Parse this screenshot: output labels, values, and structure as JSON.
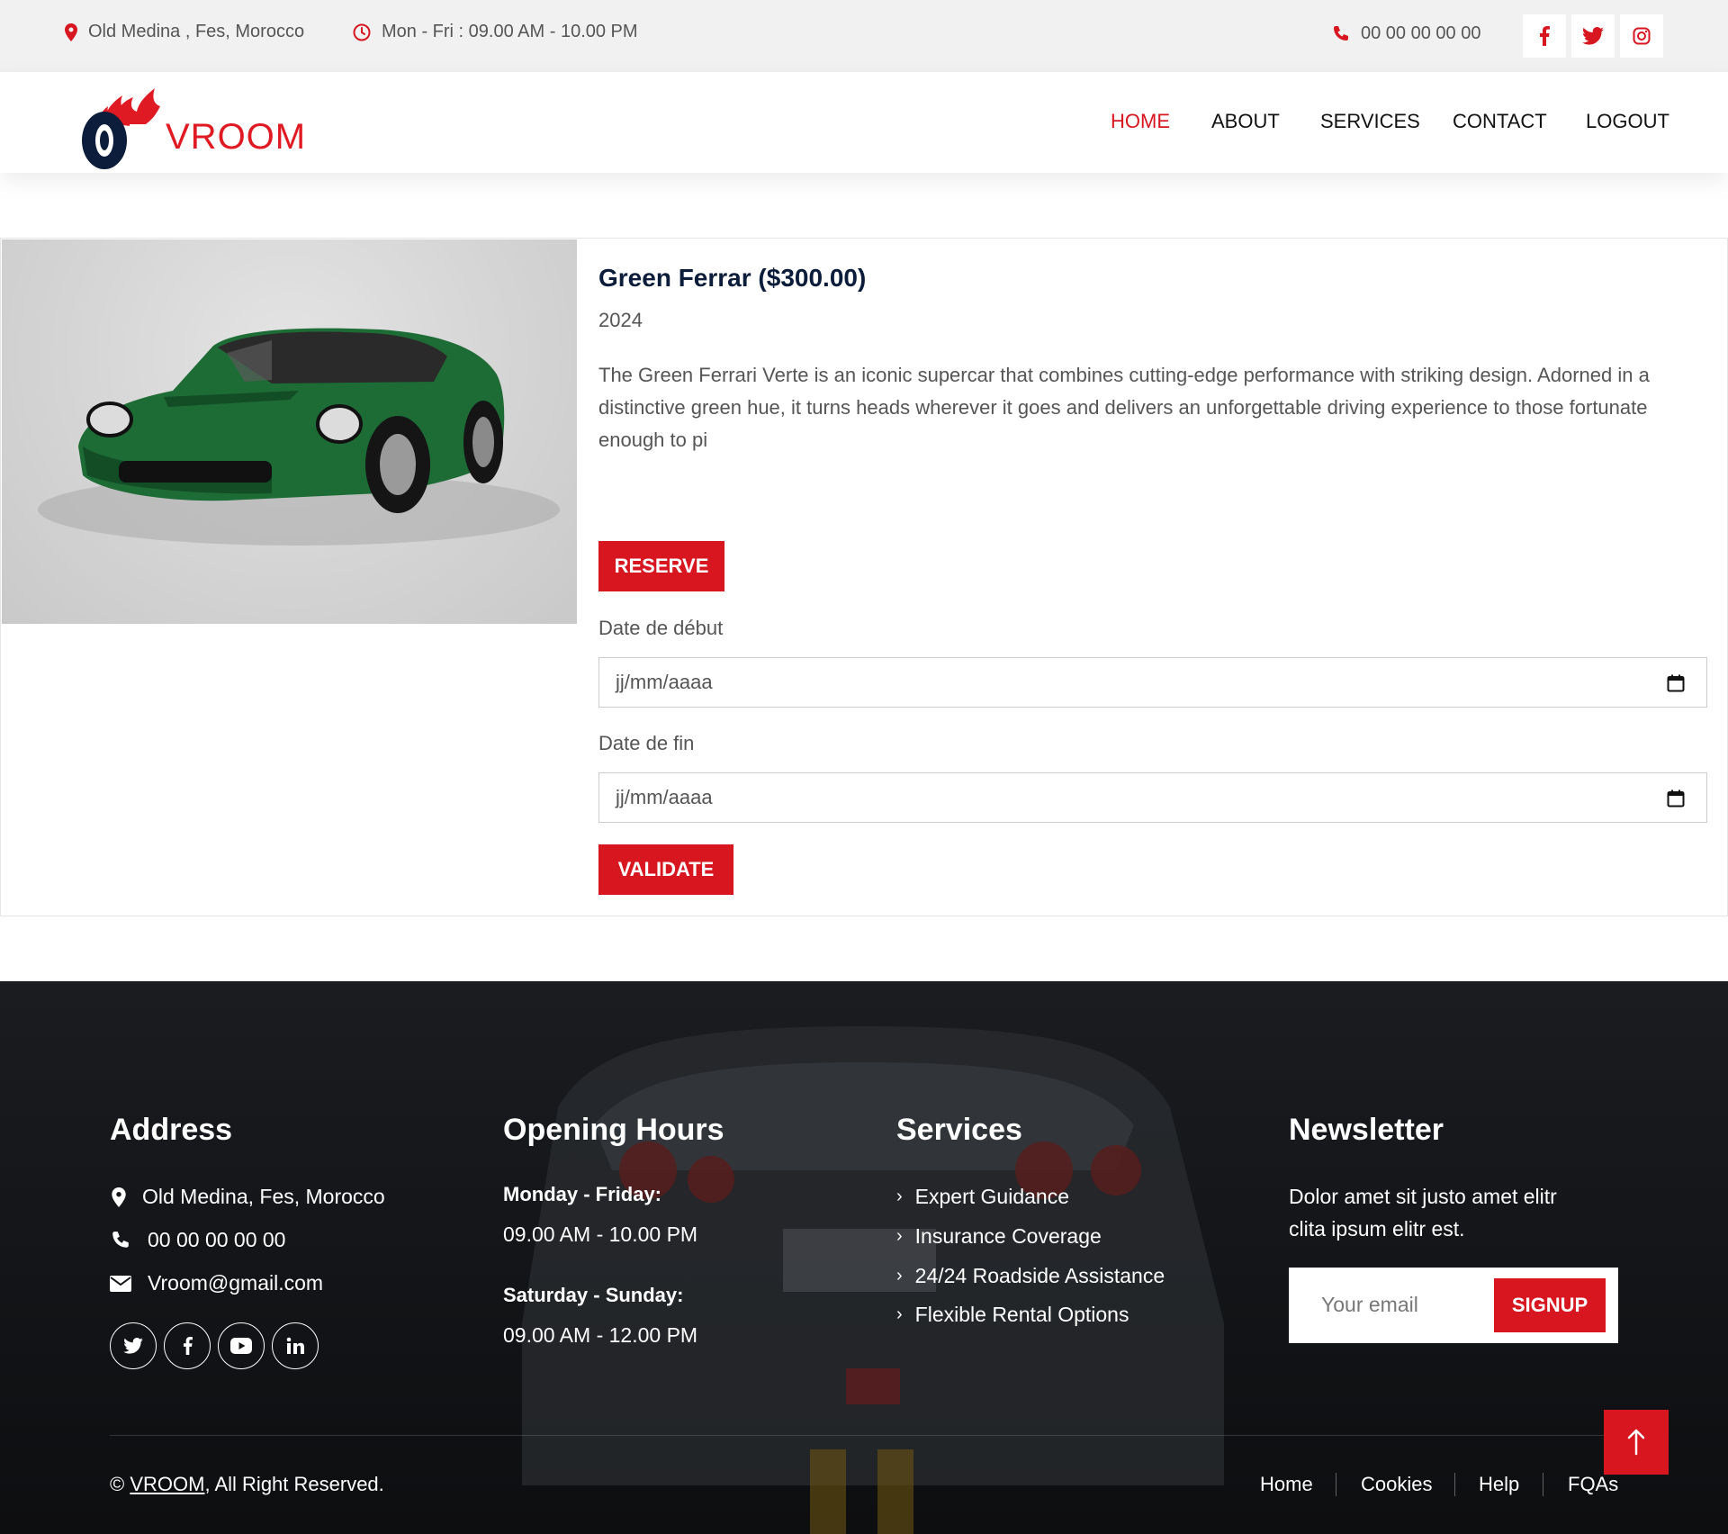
{
  "topbar": {
    "address": "Old Medina , Fes, Morocco",
    "hours": "Mon - Fri : 09.00 AM - 10.00 PM",
    "phone": "00 00 00 00 00",
    "social_icons": [
      "facebook-icon",
      "twitter-icon",
      "instagram-icon"
    ]
  },
  "brand": {
    "name": "VROOM",
    "color": "#e01a22"
  },
  "nav": {
    "items": [
      {
        "label": "HOME",
        "active": true
      },
      {
        "label": "ABOUT",
        "active": false
      },
      {
        "label": "SERVICES",
        "active": false
      },
      {
        "label": "CONTACT",
        "active": false
      },
      {
        "label": "LOGOUT",
        "active": false
      }
    ]
  },
  "car": {
    "title": "Green Ferrar ($300.00)",
    "year": "2024",
    "description": "The Green Ferrari Verte is an iconic supercar that combines cutting-edge performance with striking design. Adorned in a distinctive green hue, it turns heads wherever it goes and delivers an unforgettable driving experience to those fortunate enough to pi",
    "reserve_label": "RESERVE",
    "start_label": "Date de début",
    "start_placeholder": "jj/mm/aaaa",
    "end_label": "Date de fin",
    "end_placeholder": "jj/mm/aaaa",
    "validate_label": "VALIDATE"
  },
  "footer": {
    "address": {
      "heading": "Address",
      "location": "Old Medina, Fes, Morocco",
      "phone": "00 00 00 00 00",
      "email": "Vroom@gmail.com"
    },
    "hours": {
      "heading": "Opening Hours",
      "weekday_label": "Monday - Friday:",
      "weekday_hours": "09.00 AM - 10.00 PM",
      "weekend_label": "Saturday - Sunday:",
      "weekend_hours": "09.00 AM - 12.00 PM"
    },
    "services": {
      "heading": "Services",
      "items": [
        "Expert Guidance",
        "Insurance Coverage",
        "24/24 Roadside Assistance",
        "Flexible Rental Options"
      ]
    },
    "newsletter": {
      "heading": "Newsletter",
      "text_line1": "Dolor amet sit justo amet elitr",
      "text_line2": "clita ipsum elitr est.",
      "email_placeholder": "Your email",
      "signup_label": "SIGNUP"
    },
    "copyright_prefix": "©",
    "copyright_brand": "VROOM",
    "copyright_suffix": ", All Right Reserved.",
    "links": [
      "Home",
      "Cookies",
      "Help",
      "FQAs"
    ]
  },
  "colors": {
    "accent": "#d7161f",
    "navy": "#0b1d3a",
    "footer_bg": "#111214"
  }
}
